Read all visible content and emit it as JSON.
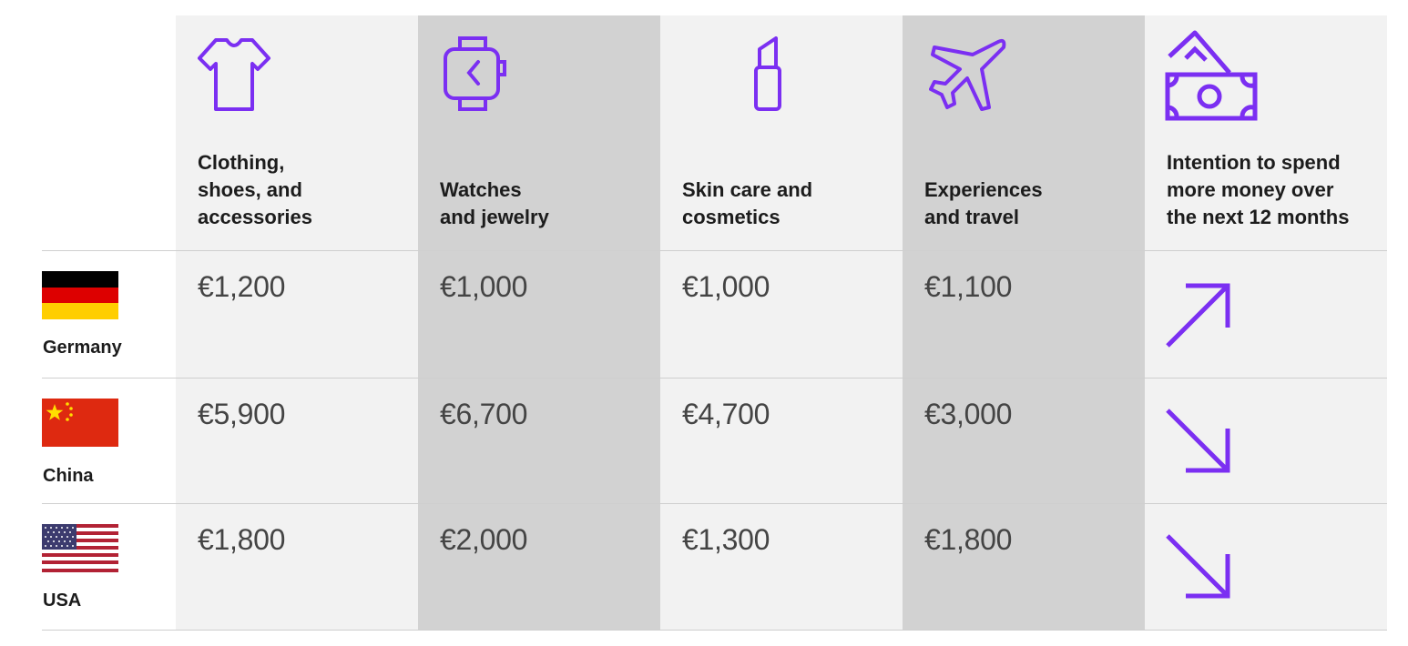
{
  "accent": "#7b2ff2",
  "columns": [
    {
      "icon": "t-shirt-icon",
      "header_lines": [
        "Clothing,",
        "shoes, and",
        "accessories"
      ]
    },
    {
      "icon": "smartwatch-icon",
      "header_lines": [
        "Watches",
        "and jewelry"
      ]
    },
    {
      "icon": "lipstick-icon",
      "header_lines": [
        "Skin care and",
        "cosmetics"
      ]
    },
    {
      "icon": "airplane-icon",
      "header_lines": [
        "Experiences",
        "and travel"
      ]
    },
    {
      "icon": "money-icon",
      "header_lines": [
        "Intention to spend",
        "more money over",
        "the next 12 months"
      ]
    }
  ],
  "rows": [
    {
      "country": "Germany",
      "flag": "germany-flag",
      "values": [
        "€1,200",
        "€1,000",
        "€1,000",
        "€1,100"
      ],
      "trend": "up"
    },
    {
      "country": "China",
      "flag": "china-flag",
      "values": [
        "€5,900",
        "€6,700",
        "€4,700",
        "€3,000"
      ],
      "trend": "down"
    },
    {
      "country": "USA",
      "flag": "usa-flag",
      "values": [
        "€1,800",
        "€2,000",
        "€1,300",
        "€1,800"
      ],
      "trend": "down"
    }
  ]
}
